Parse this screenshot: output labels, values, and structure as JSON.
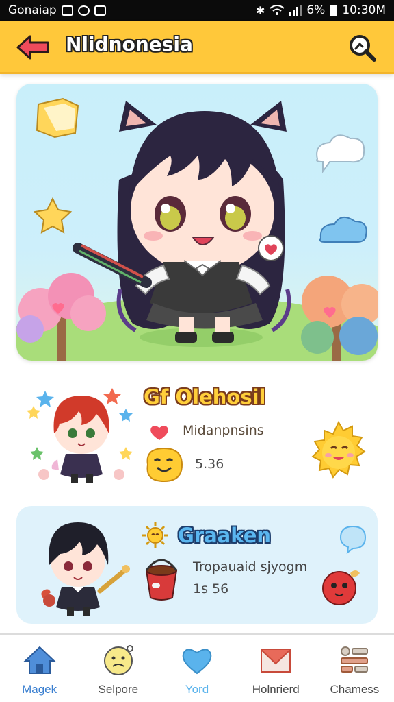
{
  "status_bar": {
    "carrier": "Gonaiap",
    "battery": "6%",
    "time": "10:30M",
    "icons": [
      "gallery-icon",
      "sync-icon",
      "mail-icon",
      "bluetooth-icon",
      "wifi-icon",
      "signal-icon",
      "battery-icon"
    ]
  },
  "app_bar": {
    "title": "Nlidnonesia",
    "back_icon": "back-arrow-icon",
    "search_icon": "search-icon",
    "color": "#ffc83a"
  },
  "hero": {
    "image": "chibi-cat-girl-illustration"
  },
  "cards": [
    {
      "title": "Gf Olehosil",
      "subtitle": "Midanpnsins",
      "number": "5.36",
      "icons": [
        "heart-icon",
        "smiley-blob-icon",
        "sun-icon"
      ]
    },
    {
      "title": "Graaken",
      "subtitle": "Tropauaid sjyogm",
      "number": "1s 56",
      "icons": [
        "sun-icon",
        "bucket-icon",
        "red-bird-icon",
        "speech-bubble-icon"
      ]
    }
  ],
  "bottom_nav": [
    {
      "label": "Magek",
      "icon": "home-icon"
    },
    {
      "label": "Selpore",
      "icon": "sad-face-icon"
    },
    {
      "label": "Yord",
      "icon": "heart-icon"
    },
    {
      "label": "Holnrierd",
      "icon": "mail-icon"
    },
    {
      "label": "Chamess",
      "icon": "list-icon"
    }
  ]
}
